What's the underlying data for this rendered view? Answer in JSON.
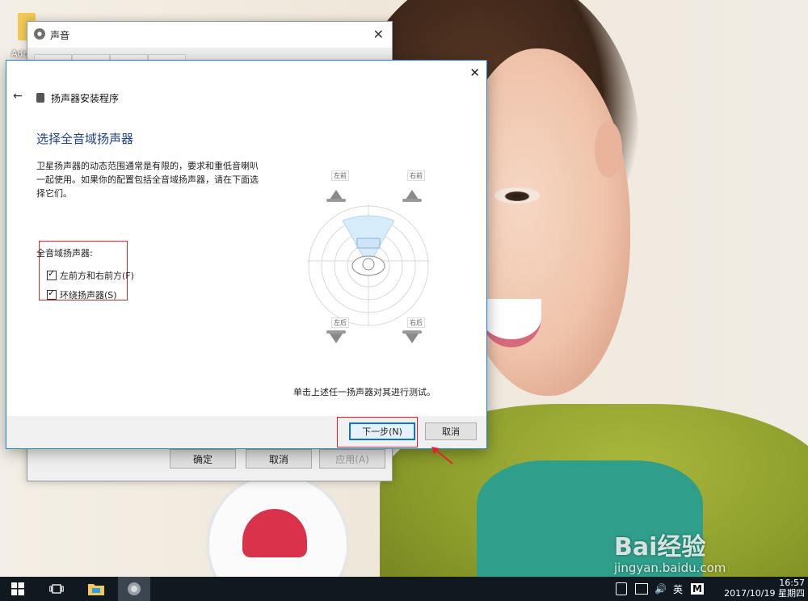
{
  "desktop": {
    "icon_label": "Admi",
    "watermark": "Bai经验",
    "watermark_url": "jingyan.baidu.com"
  },
  "sound_dialog": {
    "title": "声音",
    "close": "✕",
    "buttons": {
      "ok": "确定",
      "cancel": "取消",
      "apply": "应用(A)"
    }
  },
  "wizard": {
    "close": "✕",
    "back": "←",
    "app_title": "扬声器安装程序",
    "heading": "选择全音域扬声器",
    "description": "卫星扬声器的动态范围通常是有限的，要求和重低音喇叭一起使用。如果你的配置包括全音域扬声器，请在下面选择它们。",
    "group_label": "全音域扬声器:",
    "checkboxes": [
      {
        "label": "左前方和右前方(F)",
        "checked": true
      },
      {
        "label": "环绕扬声器(S)",
        "checked": true
      }
    ],
    "speakers": {
      "front_left": "左前",
      "front_right": "右前",
      "rear_left": "左后",
      "rear_right": "右后"
    },
    "hint": "单击上述任一扬声器对其进行测试。",
    "buttons": {
      "next": "下一步(N)",
      "cancel": "取消"
    }
  },
  "taskbar": {
    "ime": "英",
    "ime_mode": "M",
    "time": "16:57",
    "date": "2017/10/19 星期四"
  },
  "colors": {
    "accent": "#1883d7",
    "highlight": "#e0262c",
    "heading": "#1e3f8f"
  }
}
